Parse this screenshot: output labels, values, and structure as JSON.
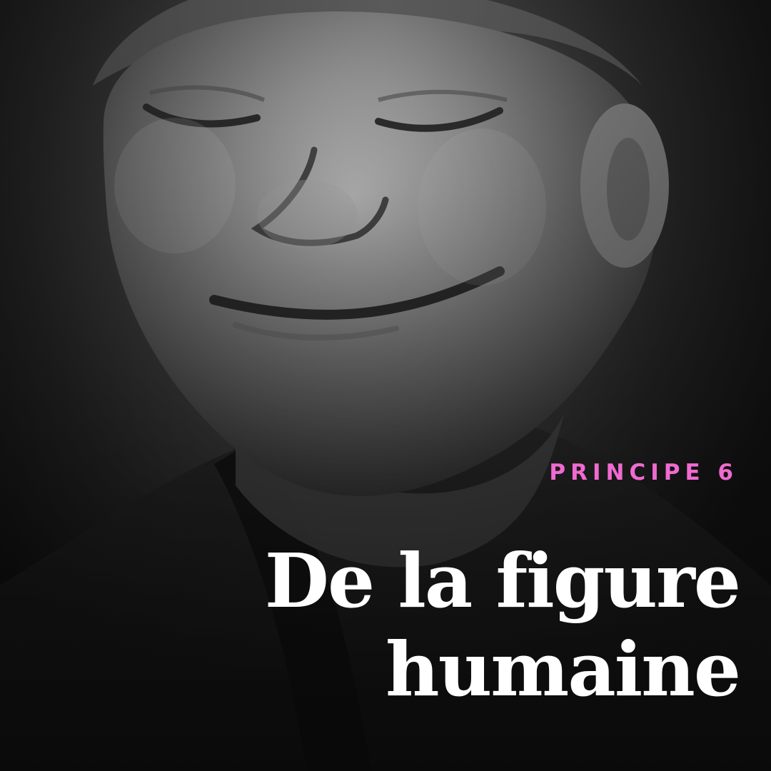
{
  "image": {
    "description_icon": "portrait-photo"
  },
  "label": {
    "eyebrow": "PRINCIPE 6",
    "title_line_1": "De la figure",
    "title_line_2": "humaine"
  },
  "colors": {
    "accent": "#f06ad0",
    "title": "#ffffff",
    "background": "#1c1c1c"
  }
}
